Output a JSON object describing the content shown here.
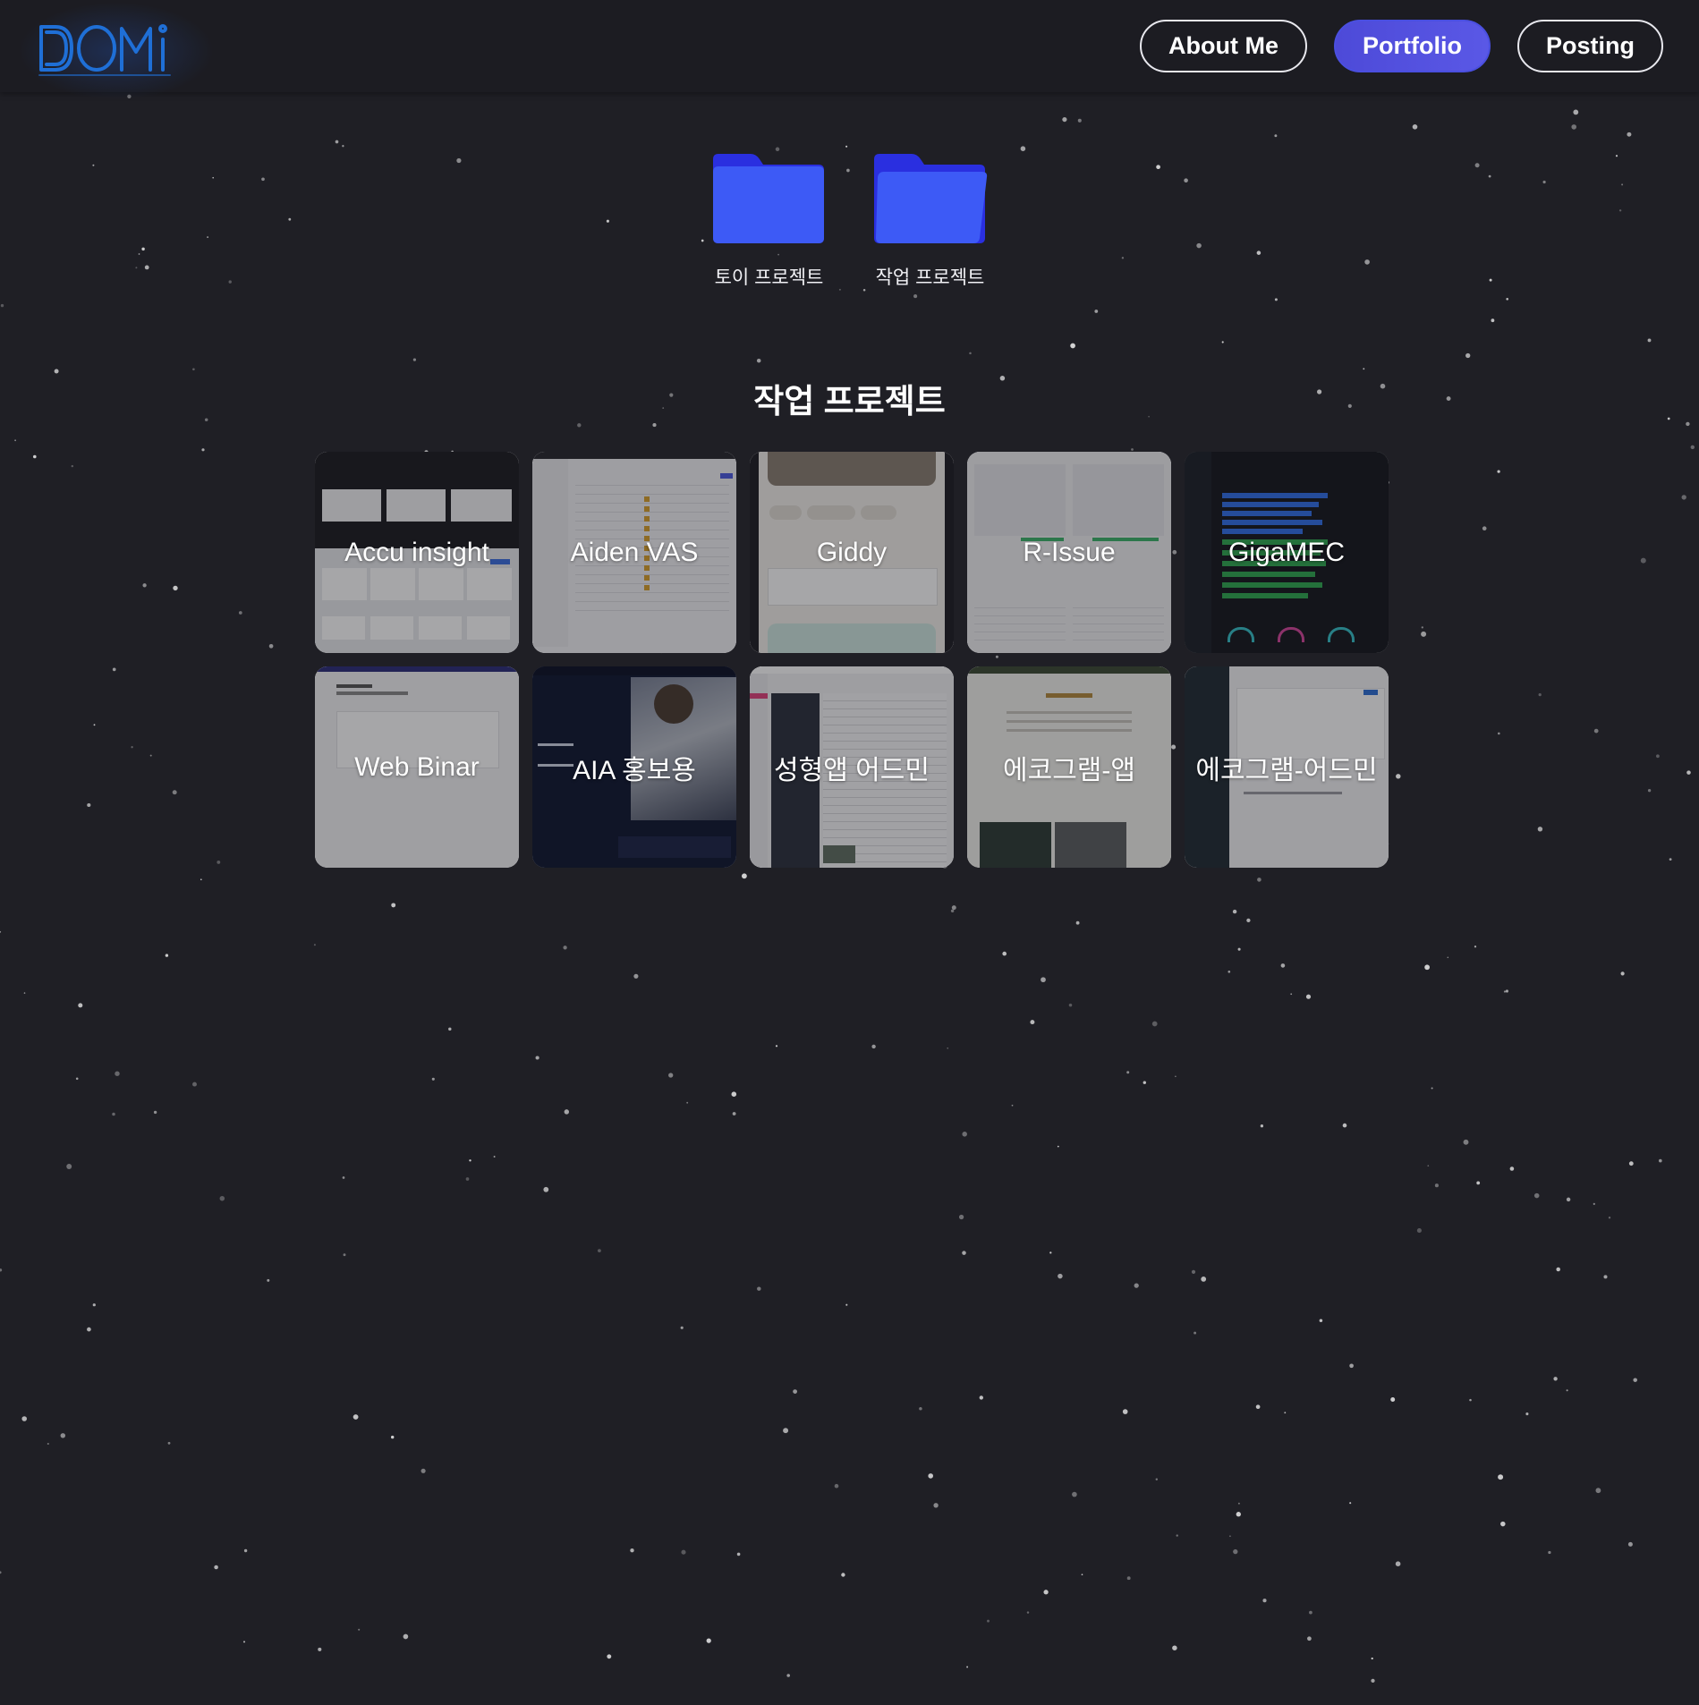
{
  "header": {
    "logo_icon": "domi-logo",
    "nav": [
      {
        "label": "About Me",
        "active": false
      },
      {
        "label": "Portfolio",
        "active": true
      },
      {
        "label": "Posting",
        "active": false
      }
    ]
  },
  "folders": [
    {
      "label": "토이 프로젝트",
      "icon": "folder-closed-icon"
    },
    {
      "label": "작업 프로젝트",
      "icon": "folder-open-icon"
    }
  ],
  "section_title": "작업 프로젝트",
  "projects": [
    {
      "label": "Accu insight"
    },
    {
      "label": "Aiden VAS"
    },
    {
      "label": "Giddy"
    },
    {
      "label": "R-Issue"
    },
    {
      "label": "GigaMEC"
    },
    {
      "label": "Web Binar"
    },
    {
      "label": "AIA 홍보용"
    },
    {
      "label": "성형앱 어드민"
    },
    {
      "label": "에코그램-앱"
    },
    {
      "label": "에코그램-어드민"
    }
  ],
  "colors": {
    "background": "#1f1f25",
    "header": "#1c1c22",
    "accent": "#4d4ad8",
    "folder": "#3c58f5",
    "logo": "#1f6fd6"
  }
}
